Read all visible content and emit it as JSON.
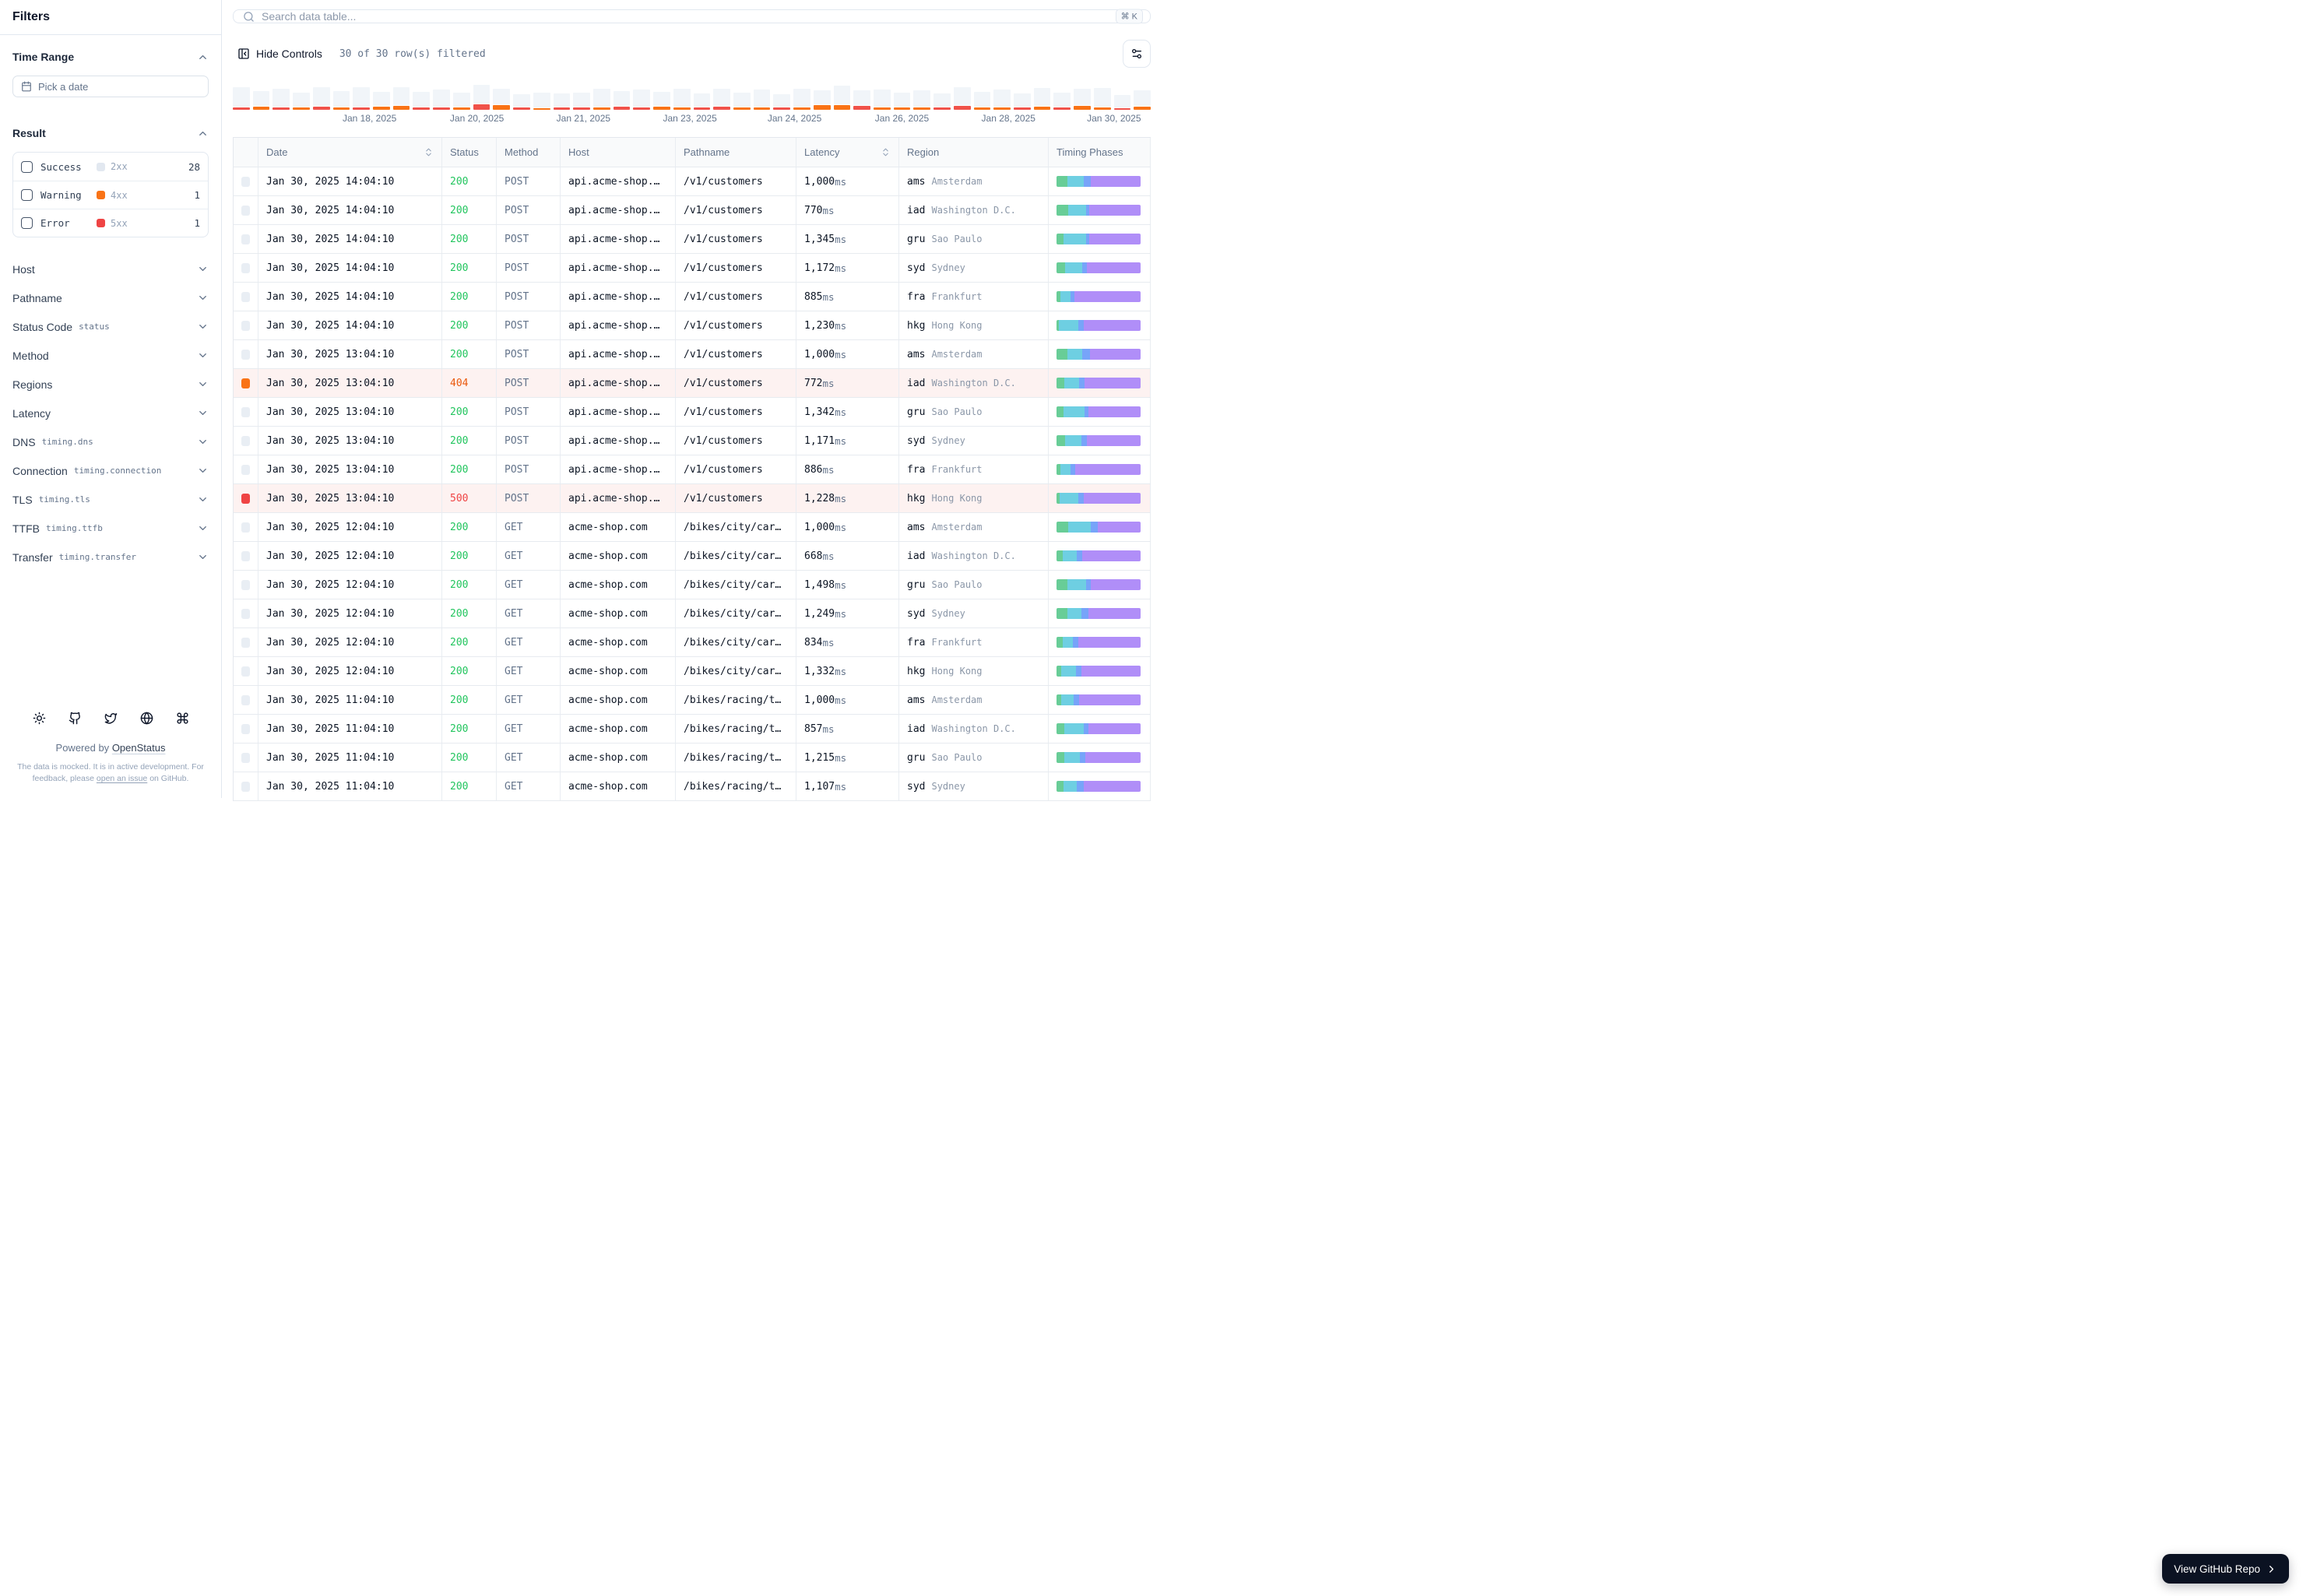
{
  "sidebar": {
    "title": "Filters",
    "time_range": {
      "label": "Time Range",
      "placeholder": "Pick a date"
    },
    "result": {
      "label": "Result",
      "items": [
        {
          "label": "Success",
          "code": "2xx",
          "count": "28",
          "color": "#e2e8f0"
        },
        {
          "label": "Warning",
          "code": "4xx",
          "count": "1",
          "color": "#f97316"
        },
        {
          "label": "Error",
          "code": "5xx",
          "count": "1",
          "color": "#ef4444"
        }
      ]
    },
    "filters": [
      {
        "label": "Host",
        "sub": ""
      },
      {
        "label": "Pathname",
        "sub": ""
      },
      {
        "label": "Status Code",
        "sub": "status"
      },
      {
        "label": "Method",
        "sub": ""
      },
      {
        "label": "Regions",
        "sub": ""
      },
      {
        "label": "Latency",
        "sub": ""
      },
      {
        "label": "DNS",
        "sub": "timing.dns"
      },
      {
        "label": "Connection",
        "sub": "timing.connection"
      },
      {
        "label": "TLS",
        "sub": "timing.tls"
      },
      {
        "label": "TTFB",
        "sub": "timing.ttfb"
      },
      {
        "label": "Transfer",
        "sub": "timing.transfer"
      }
    ],
    "footer": {
      "icons": [
        "sun-icon",
        "github-icon",
        "twitter-icon",
        "globe-icon",
        "command-icon"
      ],
      "powered_prefix": "Powered by",
      "powered_link": "OpenStatus",
      "note_pre": "The data is mocked. It is in active development. For feedback, please ",
      "note_link": "open an issue",
      "note_post": " on GitHub."
    }
  },
  "toolbar": {
    "search_placeholder": "Search data table...",
    "kbd": "⌘ K",
    "hide_controls": "Hide Controls",
    "filtered": "30 of 30 row(s) filtered"
  },
  "timeline": {
    "colors": {
      "gray": "#f1f5f9",
      "o": "#f97316",
      "r": "#f0524a"
    },
    "bars": [
      [
        95,
        "r",
        3
      ],
      [
        72,
        "o",
        4
      ],
      [
        88,
        "r",
        3
      ],
      [
        70,
        "o",
        3
      ],
      [
        92,
        "r",
        4
      ],
      [
        78,
        "o",
        3
      ],
      [
        95,
        "r",
        3
      ],
      [
        68,
        "o",
        4
      ],
      [
        90,
        "o",
        5
      ],
      [
        74,
        "r",
        3
      ],
      [
        86,
        "r",
        3
      ],
      [
        70,
        "o",
        3
      ],
      [
        92,
        "r",
        7
      ],
      [
        76,
        "o",
        6
      ],
      [
        60,
        "r",
        3
      ],
      [
        72,
        "o",
        2
      ],
      [
        64,
        "r",
        3
      ],
      [
        70,
        "r",
        3
      ],
      [
        88,
        "o",
        3
      ],
      [
        72,
        "r",
        4
      ],
      [
        84,
        "r",
        3
      ],
      [
        70,
        "o",
        4
      ],
      [
        90,
        "o",
        3
      ],
      [
        66,
        "r",
        3
      ],
      [
        84,
        "r",
        4
      ],
      [
        70,
        "o",
        3
      ],
      [
        86,
        "o",
        3
      ],
      [
        62,
        "r",
        3
      ],
      [
        88,
        "o",
        3
      ],
      [
        70,
        "o",
        6
      ],
      [
        92,
        "o",
        6
      ],
      [
        74,
        "r",
        5
      ],
      [
        86,
        "o",
        3
      ],
      [
        68,
        "o",
        3
      ],
      [
        80,
        "o",
        3
      ],
      [
        64,
        "r",
        3
      ],
      [
        88,
        "r",
        5
      ],
      [
        72,
        "o",
        3
      ],
      [
        84,
        "o",
        3
      ],
      [
        66,
        "r",
        3
      ],
      [
        90,
        "o",
        4
      ],
      [
        70,
        "r",
        3
      ],
      [
        82,
        "o",
        5
      ],
      [
        94,
        "o",
        3
      ],
      [
        60,
        "r",
        2
      ],
      [
        76,
        "o",
        4
      ]
    ],
    "labels": [
      {
        "text": "Jan 18, 2025",
        "pos": 14.9
      },
      {
        "text": "Jan 20, 2025",
        "pos": 26.6
      },
      {
        "text": "Jan 21, 2025",
        "pos": 38.2
      },
      {
        "text": "Jan 23, 2025",
        "pos": 49.8
      },
      {
        "text": "Jan 24, 2025",
        "pos": 61.2
      },
      {
        "text": "Jan 26, 2025",
        "pos": 72.9
      },
      {
        "text": "Jan 28, 2025",
        "pos": 84.5
      },
      {
        "text": "Jan 30, 2025",
        "pos": 96.0
      }
    ]
  },
  "table": {
    "columns": [
      {
        "label": "",
        "sortable": false
      },
      {
        "label": "Date",
        "sortable": true
      },
      {
        "label": "Status",
        "sortable": false
      },
      {
        "label": "Method",
        "sortable": false
      },
      {
        "label": "Host",
        "sortable": false
      },
      {
        "label": "Pathname",
        "sortable": false
      },
      {
        "label": "Latency",
        "sortable": true
      },
      {
        "label": "Region",
        "sortable": false
      },
      {
        "label": "Timing Phases",
        "sortable": false
      }
    ],
    "unit": "ms",
    "timing_colors": [
      "#68cd97",
      "#6ecfe2",
      "#77a4f9",
      "#b08ef8"
    ],
    "rows": [
      {
        "date": "Jan 30, 2025 14:04:10",
        "status": "200",
        "method": "POST",
        "host": "api.acme-shop.…",
        "path": "/v1/customers",
        "latency": "1,000",
        "region": "ams",
        "city": "Amsterdam",
        "state": "ok",
        "timing": [
          13,
          19,
          9,
          59
        ]
      },
      {
        "date": "Jan 30, 2025 14:04:10",
        "status": "200",
        "method": "POST",
        "host": "api.acme-shop.…",
        "path": "/v1/customers",
        "latency": "770",
        "region": "iad",
        "city": "Washington D.C.",
        "state": "ok",
        "timing": [
          14,
          21,
          4,
          61
        ]
      },
      {
        "date": "Jan 30, 2025 14:04:10",
        "status": "200",
        "method": "POST",
        "host": "api.acme-shop.…",
        "path": "/v1/customers",
        "latency": "1,345",
        "region": "gru",
        "city": "Sao Paulo",
        "state": "ok",
        "timing": [
          8,
          27,
          4,
          61
        ]
      },
      {
        "date": "Jan 30, 2025 14:04:10",
        "status": "200",
        "method": "POST",
        "host": "api.acme-shop.…",
        "path": "/v1/customers",
        "latency": "1,172",
        "region": "syd",
        "city": "Sydney",
        "state": "ok",
        "timing": [
          10,
          21,
          5,
          64
        ]
      },
      {
        "date": "Jan 30, 2025 14:04:10",
        "status": "200",
        "method": "POST",
        "host": "api.acme-shop.…",
        "path": "/v1/customers",
        "latency": "885",
        "region": "fra",
        "city": "Frankfurt",
        "state": "ok",
        "timing": [
          5,
          12,
          4,
          79
        ]
      },
      {
        "date": "Jan 30, 2025 14:04:10",
        "status": "200",
        "method": "POST",
        "host": "api.acme-shop.…",
        "path": "/v1/customers",
        "latency": "1,230",
        "region": "hkg",
        "city": "Hong Kong",
        "state": "ok",
        "timing": [
          3,
          23,
          6,
          68
        ]
      },
      {
        "date": "Jan 30, 2025 13:04:10",
        "status": "200",
        "method": "POST",
        "host": "api.acme-shop.…",
        "path": "/v1/customers",
        "latency": "1,000",
        "region": "ams",
        "city": "Amsterdam",
        "state": "ok",
        "timing": [
          13,
          18,
          9,
          60
        ]
      },
      {
        "date": "Jan 30, 2025 13:04:10",
        "status": "404",
        "method": "POST",
        "host": "api.acme-shop.…",
        "path": "/v1/customers",
        "latency": "772",
        "region": "iad",
        "city": "Washington D.C.",
        "state": "warn",
        "timing": [
          9,
          18,
          6,
          67
        ]
      },
      {
        "date": "Jan 30, 2025 13:04:10",
        "status": "200",
        "method": "POST",
        "host": "api.acme-shop.…",
        "path": "/v1/customers",
        "latency": "1,342",
        "region": "gru",
        "city": "Sao Paulo",
        "state": "ok",
        "timing": [
          8,
          25,
          5,
          62
        ]
      },
      {
        "date": "Jan 30, 2025 13:04:10",
        "status": "200",
        "method": "POST",
        "host": "api.acme-shop.…",
        "path": "/v1/customers",
        "latency": "1,171",
        "region": "syd",
        "city": "Sydney",
        "state": "ok",
        "timing": [
          10,
          20,
          6,
          64
        ]
      },
      {
        "date": "Jan 30, 2025 13:04:10",
        "status": "200",
        "method": "POST",
        "host": "api.acme-shop.…",
        "path": "/v1/customers",
        "latency": "886",
        "region": "fra",
        "city": "Frankfurt",
        "state": "ok",
        "timing": [
          5,
          12,
          5,
          78
        ]
      },
      {
        "date": "Jan 30, 2025 13:04:10",
        "status": "500",
        "method": "POST",
        "host": "api.acme-shop.…",
        "path": "/v1/customers",
        "latency": "1,228",
        "region": "hkg",
        "city": "Hong Kong",
        "state": "err",
        "timing": [
          4,
          22,
          6,
          68
        ]
      },
      {
        "date": "Jan 30, 2025 12:04:10",
        "status": "200",
        "method": "GET",
        "host": "acme-shop.com",
        "path": "/bikes/city/car…",
        "latency": "1,000",
        "region": "ams",
        "city": "Amsterdam",
        "state": "ok",
        "timing": [
          14,
          27,
          8,
          51
        ]
      },
      {
        "date": "Jan 30, 2025 12:04:10",
        "status": "200",
        "method": "GET",
        "host": "acme-shop.com",
        "path": "/bikes/city/car…",
        "latency": "668",
        "region": "iad",
        "city": "Washington D.C.",
        "state": "ok",
        "timing": [
          7,
          17,
          7,
          69
        ]
      },
      {
        "date": "Jan 30, 2025 12:04:10",
        "status": "200",
        "method": "GET",
        "host": "acme-shop.com",
        "path": "/bikes/city/car…",
        "latency": "1,498",
        "region": "gru",
        "city": "Sao Paulo",
        "state": "ok",
        "timing": [
          13,
          22,
          6,
          59
        ]
      },
      {
        "date": "Jan 30, 2025 12:04:10",
        "status": "200",
        "method": "GET",
        "host": "acme-shop.com",
        "path": "/bikes/city/car…",
        "latency": "1,249",
        "region": "syd",
        "city": "Sydney",
        "state": "ok",
        "timing": [
          13,
          17,
          8,
          62
        ]
      },
      {
        "date": "Jan 30, 2025 12:04:10",
        "status": "200",
        "method": "GET",
        "host": "acme-shop.com",
        "path": "/bikes/city/car…",
        "latency": "834",
        "region": "fra",
        "city": "Frankfurt",
        "state": "ok",
        "timing": [
          7,
          12,
          7,
          74
        ]
      },
      {
        "date": "Jan 30, 2025 12:04:10",
        "status": "200",
        "method": "GET",
        "host": "acme-shop.com",
        "path": "/bikes/city/car…",
        "latency": "1,332",
        "region": "hkg",
        "city": "Hong Kong",
        "state": "ok",
        "timing": [
          6,
          17,
          7,
          70
        ]
      },
      {
        "date": "Jan 30, 2025 11:04:10",
        "status": "200",
        "method": "GET",
        "host": "acme-shop.com",
        "path": "/bikes/racing/t…",
        "latency": "1,000",
        "region": "ams",
        "city": "Amsterdam",
        "state": "ok",
        "timing": [
          6,
          14,
          7,
          73
        ]
      },
      {
        "date": "Jan 30, 2025 11:04:10",
        "status": "200",
        "method": "GET",
        "host": "acme-shop.com",
        "path": "/bikes/racing/t…",
        "latency": "857",
        "region": "iad",
        "city": "Washington D.C.",
        "state": "ok",
        "timing": [
          9,
          23,
          6,
          62
        ]
      },
      {
        "date": "Jan 30, 2025 11:04:10",
        "status": "200",
        "method": "GET",
        "host": "acme-shop.com",
        "path": "/bikes/racing/t…",
        "latency": "1,215",
        "region": "gru",
        "city": "Sao Paulo",
        "state": "ok",
        "timing": [
          9,
          19,
          6,
          66
        ]
      },
      {
        "date": "Jan 30, 2025 11:04:10",
        "status": "200",
        "method": "GET",
        "host": "acme-shop.com",
        "path": "/bikes/racing/t…",
        "latency": "1,107",
        "region": "syd",
        "city": "Sydney",
        "state": "ok",
        "timing": [
          8,
          16,
          8,
          68
        ]
      }
    ]
  },
  "github_button": {
    "label": "View GitHub Repo"
  }
}
